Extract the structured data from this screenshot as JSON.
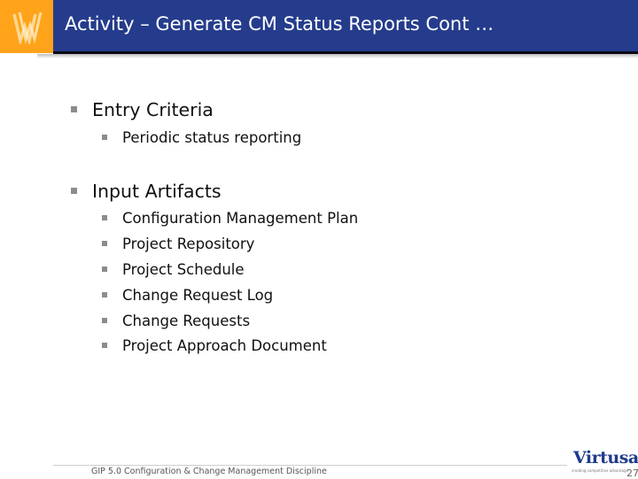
{
  "header": {
    "logo_icon": "ww-monogram-icon",
    "title": "Activity – Generate CM Status Reports Cont …",
    "colors": {
      "band": "#253c8c",
      "logo_bg": "#ffa31a",
      "rule": "#0a0a14"
    }
  },
  "content": {
    "sections": [
      {
        "heading": "Entry Criteria",
        "items": [
          "Periodic status reporting"
        ]
      },
      {
        "heading": "Input Artifacts",
        "items": [
          "Configuration Management Plan",
          "Project Repository",
          "Project Schedule",
          "Change Request Log",
          "Change Requests",
          "Project Approach Document"
        ]
      }
    ],
    "bullet_icon": "square-bullet-icon",
    "bullet_color": "#8c8c8c"
  },
  "footer": {
    "text": "GIP 5.0 Configuration & Change Management Discipline",
    "brand": "Virtusa",
    "brand_tagline": "creating competitive advantage",
    "page_number": "27"
  }
}
